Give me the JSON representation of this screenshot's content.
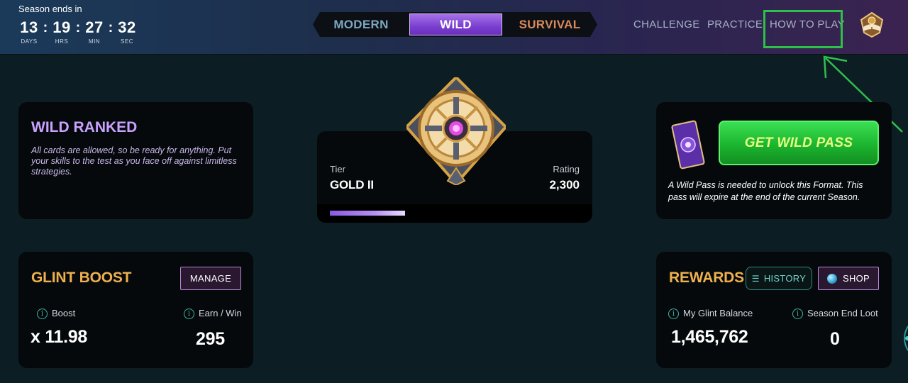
{
  "season": {
    "label": "Season ends in",
    "timer": [
      {
        "value": "13",
        "unit": "DAYS"
      },
      {
        "value": "19",
        "unit": "HRS"
      },
      {
        "value": "27",
        "unit": "MIN"
      },
      {
        "value": "32",
        "unit": "SEC"
      }
    ],
    "separator": ":"
  },
  "modes": {
    "modern": "MODERN",
    "wild": "WILD",
    "survival": "SURVIVAL",
    "selected": "WILD"
  },
  "nav": {
    "challenge": "CHALLENGE",
    "practice": "PRACTICE",
    "how_to_play": "HOW TO PLAY"
  },
  "wild_ranked": {
    "title": "WILD RANKED",
    "description": "All cards are allowed, so be ready for anything. Put your skills to the test as you face off against limitless strategies."
  },
  "tier": {
    "tier_label": "Tier",
    "tier_value": "GOLD II",
    "rating_label": "Rating",
    "rating_value": "2,300",
    "progress_fraction": 0.3
  },
  "wild_pass": {
    "button": "GET WILD PASS",
    "description": "A Wild Pass is needed to unlock this Format. This pass will expire at the end of the current Season."
  },
  "glint_boost": {
    "title": "GLINT BOOST",
    "manage": "MANAGE",
    "boost_label": "Boost",
    "boost_value": "x 11.98",
    "earn_label": "Earn / Win",
    "earn_value": "295"
  },
  "rewards": {
    "title": "REWARDS",
    "history": "HISTORY",
    "shop": "SHOP",
    "balance_label": "My Glint Balance",
    "balance_value": "1,465,762",
    "loot_label": "Season End Loot",
    "loot_value": "0"
  },
  "colors": {
    "accent_purple": "#9b63e8",
    "wild_title": "#c9a2ff",
    "gold_title": "#efb04f",
    "green_button": "#22c43a",
    "annotation": "#2ec04a"
  },
  "icons": {
    "avatar": "avatar-emblem-icon",
    "info": "info-icon",
    "history": "list-icon",
    "shop": "glint-orb-icon"
  }
}
